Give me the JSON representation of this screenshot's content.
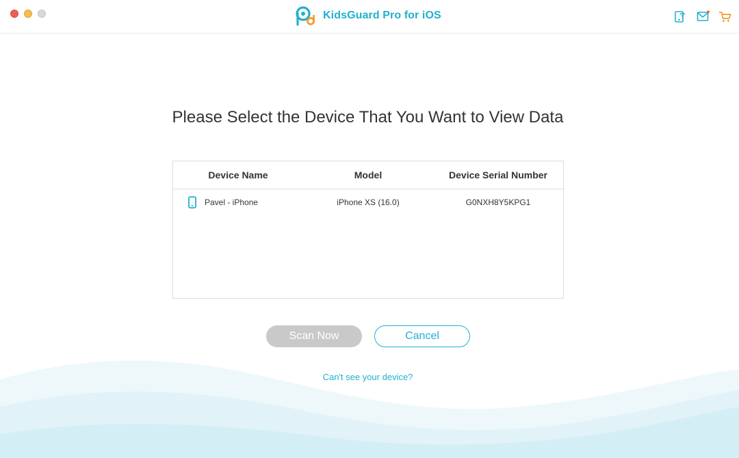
{
  "app": {
    "title": "KidsGuard Pro for iOS"
  },
  "colors": {
    "accent": "#1fb0cd",
    "scan_button_bg": "#c9c9c9",
    "cart_icon": "#f39a2c",
    "heading_text": "#333333"
  },
  "toolbar": {
    "icons": [
      "device-wifi-icon",
      "mail-icon",
      "cart-icon"
    ]
  },
  "main": {
    "heading": "Please Select the Device That You Want to View Data",
    "table": {
      "columns": [
        "Device Name",
        "Model",
        "Device Serial Number"
      ],
      "rows": [
        {
          "icon": "phone-icon",
          "name": "Pavel - iPhone",
          "model": "iPhone XS (16.0)",
          "serial": "G0NXH8Y5KPG1"
        }
      ]
    },
    "buttons": {
      "scan": "Scan Now",
      "cancel": "Cancel"
    },
    "help_link": "Can't see your device?"
  }
}
